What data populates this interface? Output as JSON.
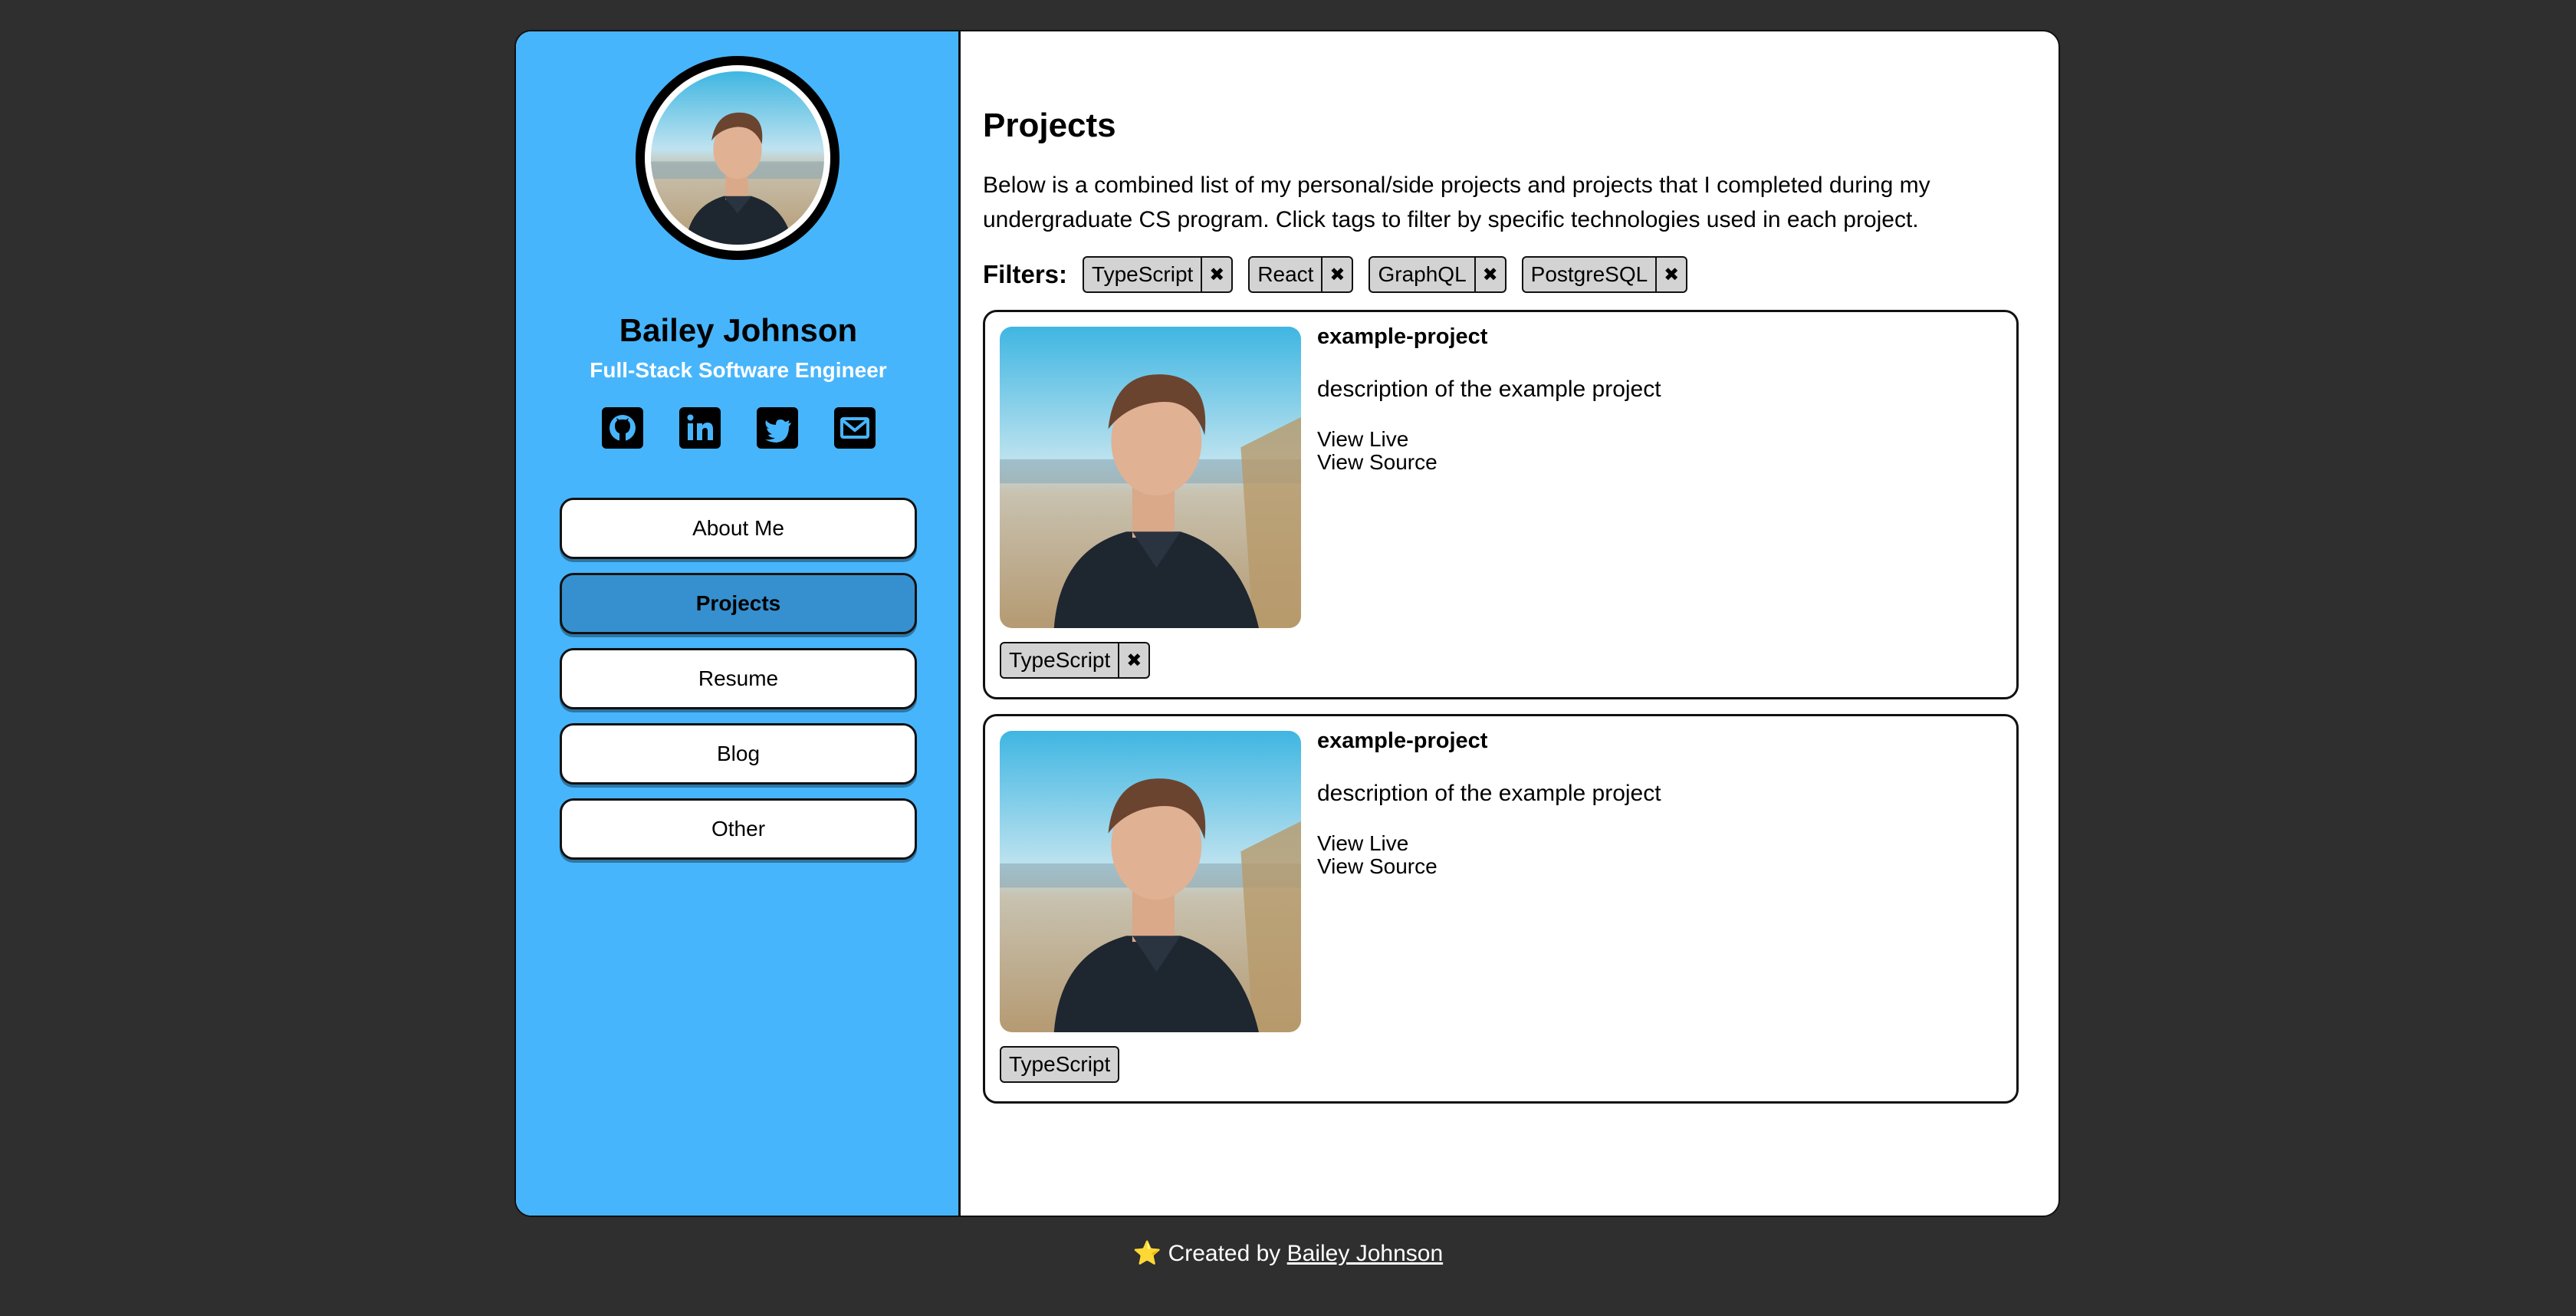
{
  "profile": {
    "name": "Bailey Johnson",
    "title": "Full-Stack Software Engineer"
  },
  "socials": [
    {
      "icon": "github-icon"
    },
    {
      "icon": "linkedin-icon"
    },
    {
      "icon": "twitter-icon"
    },
    {
      "icon": "envelope-icon"
    }
  ],
  "nav": {
    "items": [
      {
        "label": "About Me"
      },
      {
        "label": "Projects"
      },
      {
        "label": "Resume"
      },
      {
        "label": "Blog"
      },
      {
        "label": "Other"
      }
    ],
    "active": "Projects"
  },
  "main": {
    "heading": "Projects",
    "intro": "Below is a combined list of my personal/side projects and projects that I completed during my undergraduate CS program. Click tags to filter by specific technologies used in each project.",
    "filters_label": "Filters:",
    "filters": [
      {
        "label": "TypeScript",
        "remove": "✖"
      },
      {
        "label": "React",
        "remove": "✖"
      },
      {
        "label": "GraphQL",
        "remove": "✖"
      },
      {
        "label": "PostgreSQL",
        "remove": "✖"
      }
    ],
    "projects": [
      {
        "title": "example-project",
        "description": "description of the example project",
        "live_label": "View Live",
        "source_label": "View Source",
        "tags": [
          {
            "label": "TypeScript",
            "remove": "✖"
          }
        ]
      },
      {
        "title": "example-project",
        "description": "description of the example project",
        "live_label": "View Live",
        "source_label": "View Source",
        "tags": [
          {
            "label": "TypeScript"
          }
        ]
      }
    ]
  },
  "footer": {
    "star": "⭐",
    "prefix": "Created by",
    "link": "Bailey Johnson"
  },
  "colors": {
    "page_bg": "#2f2f2f",
    "sidebar_bg": "#47b5fc",
    "active_nav": "#3690cf",
    "tag_bg": "#d3d3d3"
  }
}
